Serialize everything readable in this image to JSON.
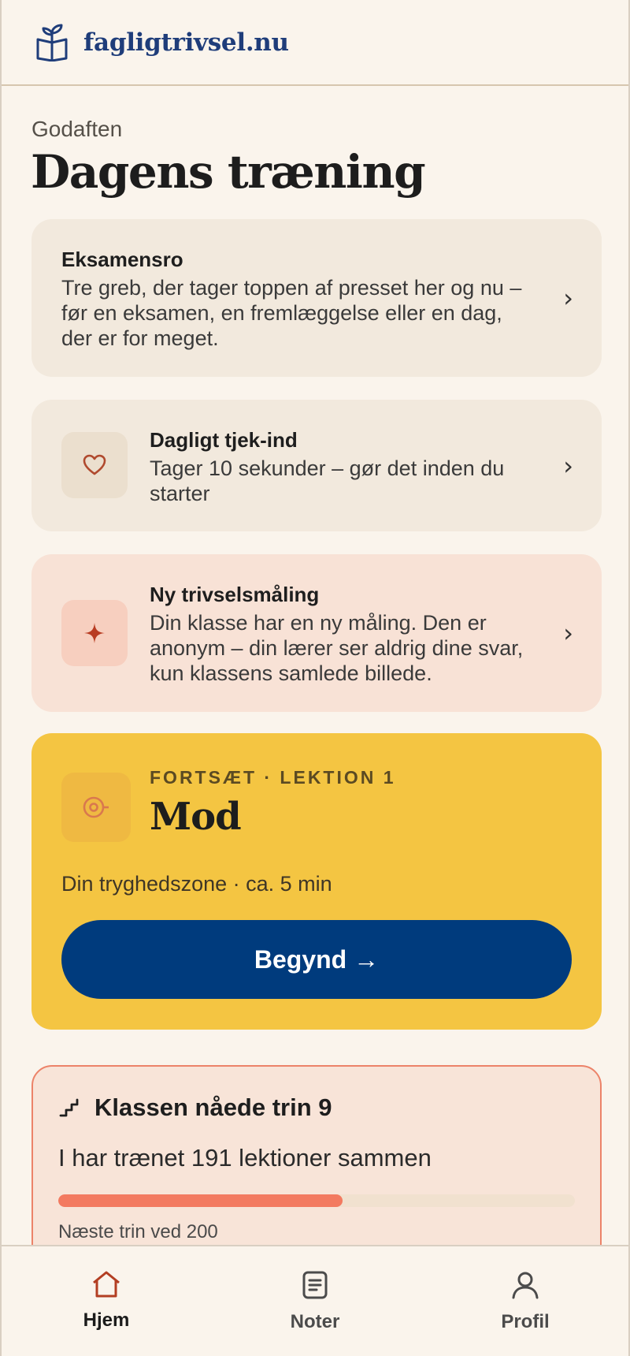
{
  "header": {
    "brand": "fagligtrivsel.nu",
    "logo_icon": "book-plant-icon",
    "brand_color": "#1f3d7a"
  },
  "page": {
    "greeting": "Godaften",
    "title": "Dagens træning"
  },
  "cards": {
    "exam": {
      "title": "Eksamensro",
      "text": "Tre greb, der tager toppen af presset her og nu – før en eksamen, en fremlæggelse eller en dag, der er for meget.",
      "chevron": "›"
    },
    "checkin": {
      "icon": "heart-icon",
      "title": "Dagligt tjek-ind",
      "text": "Tager 10 sekunder – gør det inden du starter",
      "chevron": "›"
    },
    "survey": {
      "icon": "sparkle-icon",
      "title": "Ny trivselsmåling",
      "text": "Din klasse har en ny måling. Den er anonym – din lærer ser aldrig dine svar, kun klassens samlede billede.",
      "chevron": "›"
    },
    "lesson": {
      "icon": "target-icon",
      "label": "FORTSÆT · LEKTION 1",
      "title": "Mod",
      "meta": "Din tryghedszone · ca. 5 min",
      "button": "Begynd →",
      "accent": "#f4c542",
      "button_color": "#003b7d"
    },
    "progress": {
      "icon": "stairs-icon",
      "title": "Klassen nåede trin 9",
      "subtitle": "I har trænet 191 lektioner sammen",
      "progress_fraction": 0.55,
      "next": "Næste trin ved 200",
      "bar_color": "#f37a60"
    }
  },
  "nav": {
    "home": {
      "label": "Hjem",
      "icon": "home-icon",
      "active": true
    },
    "notes": {
      "label": "Noter",
      "icon": "notes-icon"
    },
    "profile": {
      "label": "Profil",
      "icon": "profile-icon"
    }
  }
}
